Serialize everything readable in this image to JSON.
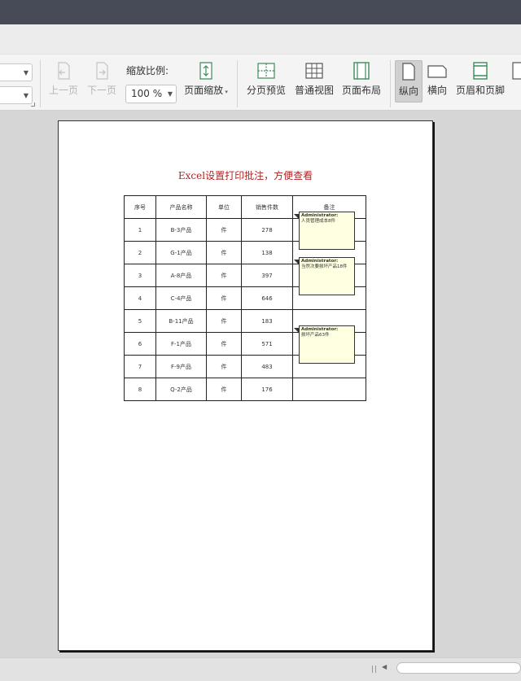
{
  "toolbar": {
    "prev_page": "上一页",
    "next_page": "下一页",
    "zoom_label": "缩放比例:",
    "zoom_value": "100 %",
    "page_zoom": "页面缩放",
    "page_break_preview": "分页预览",
    "normal_view": "普通视图",
    "page_layout": "页面布局",
    "portrait": "纵向",
    "landscape": "横向",
    "header_footer": "页眉和页脚"
  },
  "sheet": {
    "title": "Excel设置打印批注，方便查看",
    "headers": [
      "序号",
      "产品名称",
      "单位",
      "销售件数",
      "备注"
    ],
    "rows": [
      [
        "1",
        "B-3产品",
        "件",
        "278",
        ""
      ],
      [
        "2",
        "G-1产品",
        "件",
        "138",
        ""
      ],
      [
        "3",
        "A-8产品",
        "件",
        "397",
        ""
      ],
      [
        "4",
        "C-4产品",
        "件",
        "646",
        ""
      ],
      [
        "5",
        "B-11产品",
        "件",
        "183",
        ""
      ],
      [
        "6",
        "F-1产品",
        "件",
        "571",
        ""
      ],
      [
        "7",
        "F-9产品",
        "件",
        "483",
        ""
      ],
      [
        "8",
        "Q-2产品",
        "件",
        "176",
        ""
      ]
    ],
    "comments": [
      {
        "author": "Administrator:",
        "text": "人员管理成本8件"
      },
      {
        "author": "Administrator:",
        "text": "当然次要损坏产品18件"
      },
      {
        "author": "Administrator:",
        "text": "损坏产品63件"
      }
    ]
  },
  "colors": {
    "title_bar": "#474a57",
    "sheet_title": "#b22222",
    "comment_bg": "#ffffe1"
  }
}
